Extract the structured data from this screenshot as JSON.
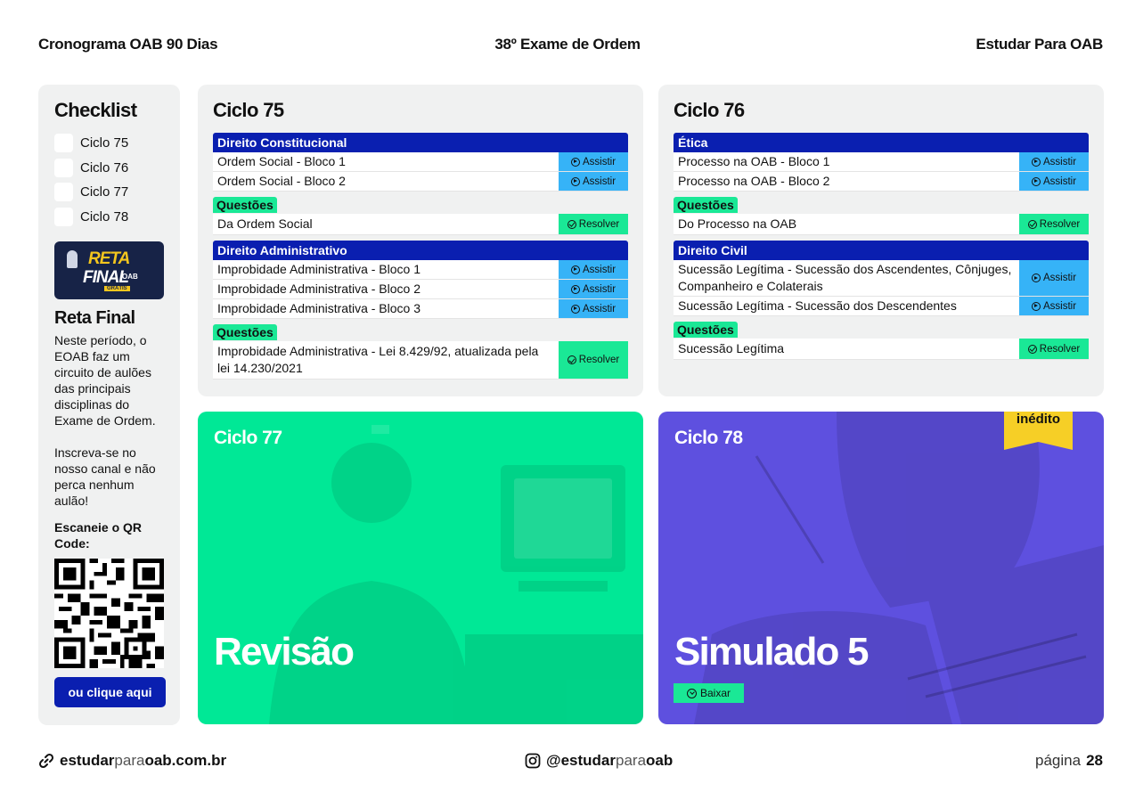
{
  "header": {
    "left": "Cronograma OAB 90 Dias",
    "center": "38º Exame de Ordem",
    "right": "Estudar Para OAB"
  },
  "sidebar": {
    "title": "Checklist",
    "items": [
      "Ciclo 75",
      "Ciclo 76",
      "Ciclo 77",
      "Ciclo 78"
    ],
    "promo": {
      "line1": "RETA",
      "line2": "FINAL",
      "line3": "OAB",
      "badge": "GRÁTIS"
    },
    "promo_title": "Reta Final",
    "promo_text": "Neste período, o EOAB faz um circuito de aulões das principais disciplinas do Exame de Ordem.",
    "promo_text2": "Inscreva-se no nosso canal e não perca nenhum aulão!",
    "scan_label": "Escaneie o QR Code:",
    "click_label": "ou clique aqui"
  },
  "labels": {
    "assistir": "Assistir",
    "resolver": "Resolver",
    "questoes": "Questões",
    "baixar": "Baixar",
    "inedito": "inédito"
  },
  "ciclo75": {
    "title": "Ciclo 75",
    "s1": {
      "name": "Direito Constitucional",
      "lessons": [
        "Ordem Social - Bloco 1",
        "Ordem Social - Bloco 2"
      ],
      "questoes": "Da Ordem Social"
    },
    "s2": {
      "name": "Direito Administrativo",
      "lessons": [
        "Improbidade Administrativa - Bloco 1",
        "Improbidade Administrativa - Bloco 2",
        "Improbidade Administrativa - Bloco 3"
      ],
      "questoes": "Improbidade Administrativa - Lei 8.429/92, atualizada pela lei 14.230/2021"
    }
  },
  "ciclo76": {
    "title": "Ciclo 76",
    "s1": {
      "name": "Ética",
      "lessons": [
        "Processo na OAB - Bloco 1",
        "Processo na OAB - Bloco 2"
      ],
      "questoes": "Do Processo na OAB"
    },
    "s2": {
      "name": "Direito Civil",
      "lessons": [
        "Sucessão Legítima - Sucessão dos Ascendentes, Cônjuges, Companheiro e Colaterais",
        "Sucessão Legítima - Sucessão dos Descendentes"
      ],
      "questoes": "Sucessão Legítima"
    }
  },
  "ciclo77": {
    "title": "Ciclo 77",
    "big": "Revisão"
  },
  "ciclo78": {
    "title": "Ciclo 78",
    "big": "Simulado 5"
  },
  "footer": {
    "site_b1": "estudar",
    "site_l": "para",
    "site_b2": "oab.com.br",
    "insta_b1": "@estudar",
    "insta_l": "para",
    "insta_b2": "oab",
    "page_label": "página",
    "page_num": "28"
  },
  "colors": {
    "accent_blue": "#0a1fb0",
    "assist": "#36b3f7",
    "resolve": "#1ae896",
    "green_card": "#00e896",
    "purple_card": "#5e50df",
    "tag_yellow": "#f6cf26"
  },
  "icons": [
    "link-icon",
    "instagram-icon",
    "play-icon",
    "check-circle-icon",
    "download-icon"
  ]
}
